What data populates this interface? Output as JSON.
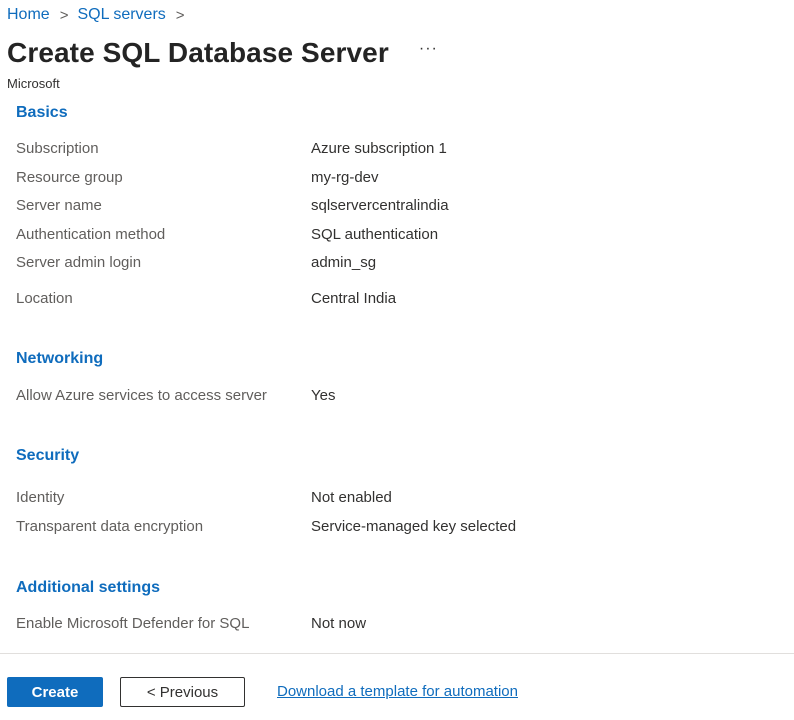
{
  "breadcrumb": {
    "items": [
      {
        "label": "Home"
      },
      {
        "label": "SQL servers"
      }
    ],
    "separator": ">"
  },
  "header": {
    "title": "Create SQL Database Server",
    "more_label": "···",
    "publisher": "Microsoft"
  },
  "sections": {
    "basics": {
      "title": "Basics",
      "rows": [
        {
          "label": "Subscription",
          "value": "Azure subscription 1"
        },
        {
          "label": "Resource group",
          "value": "my-rg-dev"
        },
        {
          "label": "Server name",
          "value": "sqlservercentralindia"
        },
        {
          "label": "Authentication method",
          "value": "SQL authentication"
        },
        {
          "label": "Server admin login",
          "value": "admin_sg"
        },
        {
          "label": "Location",
          "value": "Central India"
        }
      ]
    },
    "networking": {
      "title": "Networking",
      "rows": [
        {
          "label": "Allow Azure services to access server",
          "value": "Yes"
        }
      ]
    },
    "security": {
      "title": "Security",
      "rows": [
        {
          "label": "Identity",
          "value": "Not enabled"
        },
        {
          "label": "Transparent data encryption",
          "value": "Service-managed key selected"
        }
      ]
    },
    "additional": {
      "title": "Additional settings",
      "rows": [
        {
          "label": "Enable Microsoft Defender for SQL",
          "value": "Not now"
        }
      ]
    }
  },
  "footer": {
    "create_label": "Create",
    "previous_label": "< Previous",
    "template_link": "Download a template for automation"
  },
  "colors": {
    "accent": "#0f6cbd",
    "text": "#323130",
    "label": "#605e5c"
  }
}
